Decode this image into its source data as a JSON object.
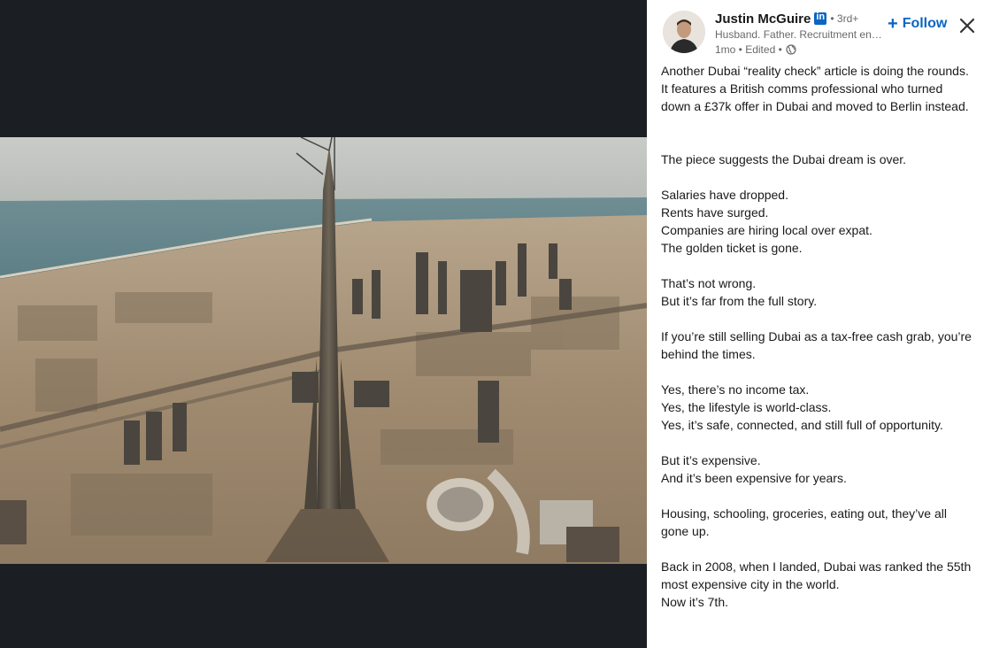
{
  "author": {
    "name": "Justin McGuire",
    "degree": "• 3rd+",
    "headline": "Husband. Father. Recruitment ent...",
    "meta": "1mo • Edited •"
  },
  "actions": {
    "follow_label": "Follow"
  },
  "post": {
    "paragraphs": [
      [
        "Another Dubai “reality check” article is doing the rounds.",
        "It features a British comms professional who turned down a £37k offer in Dubai and moved to Berlin instead."
      ],
      [
        "The piece suggests the Dubai dream is over."
      ],
      [
        "Salaries have dropped.",
        "Rents have surged.",
        "Companies are hiring local over expat.",
        "The golden ticket is gone."
      ],
      [
        "That’s not wrong.",
        "But it’s far from the full story."
      ],
      [
        "If you’re still selling Dubai as a tax-free cash grab, you’re behind the times."
      ],
      [
        "Yes, there’s no income tax.",
        "Yes, the lifestyle is world-class.",
        "Yes, it’s safe, connected, and still full of opportunity."
      ],
      [
        "But it’s expensive.",
        "And it’s been expensive for years."
      ],
      [
        "Housing, schooling, groceries, eating out, they’ve all gone up."
      ],
      [
        "Back in 2008, when I landed, Dubai was ranked the 55th most expensive city in the world.",
        "Now it’s 7th."
      ]
    ]
  },
  "icons": {
    "linkedin_badge": "linkedin-icon",
    "globe": "globe-icon",
    "close": "close-icon",
    "follow_plus": "plus-icon"
  },
  "colors": {
    "accent": "#0a66c2",
    "backdrop": "#1b1f23"
  }
}
